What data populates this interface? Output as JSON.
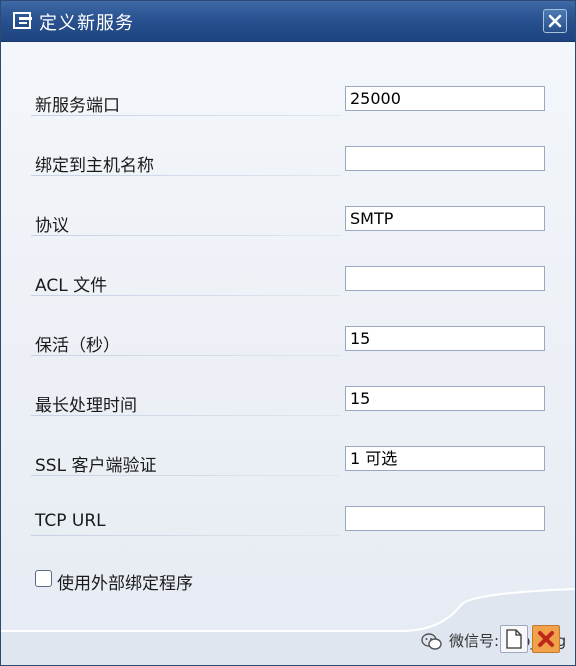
{
  "window": {
    "title": "定义新服务"
  },
  "form": {
    "fields": [
      {
        "label": "新服务端口",
        "value": "25000"
      },
      {
        "label": "绑定到主机名称",
        "value": ""
      },
      {
        "label": "协议",
        "value": "SMTP"
      },
      {
        "label": "ACL 文件",
        "value": ""
      },
      {
        "label": "保活（秒）",
        "value": "15"
      },
      {
        "label": "最长处理时间",
        "value": "15"
      },
      {
        "label": "SSL 客户端验证",
        "value": "1 可选"
      },
      {
        "label": "TCP URL",
        "value": ""
      }
    ],
    "checkbox": {
      "label": "使用外部绑定程序",
      "checked": false
    }
  },
  "footer": {
    "watermark": "微信号: sap_img"
  },
  "icons": {
    "title": "dialog-icon",
    "close": "close-icon",
    "new": "new-document-icon",
    "cancel": "cancel-icon",
    "watermark": "wechat-icon"
  },
  "colors": {
    "titlebar": "#2a5290",
    "cancel_button": "#f0a14a"
  }
}
